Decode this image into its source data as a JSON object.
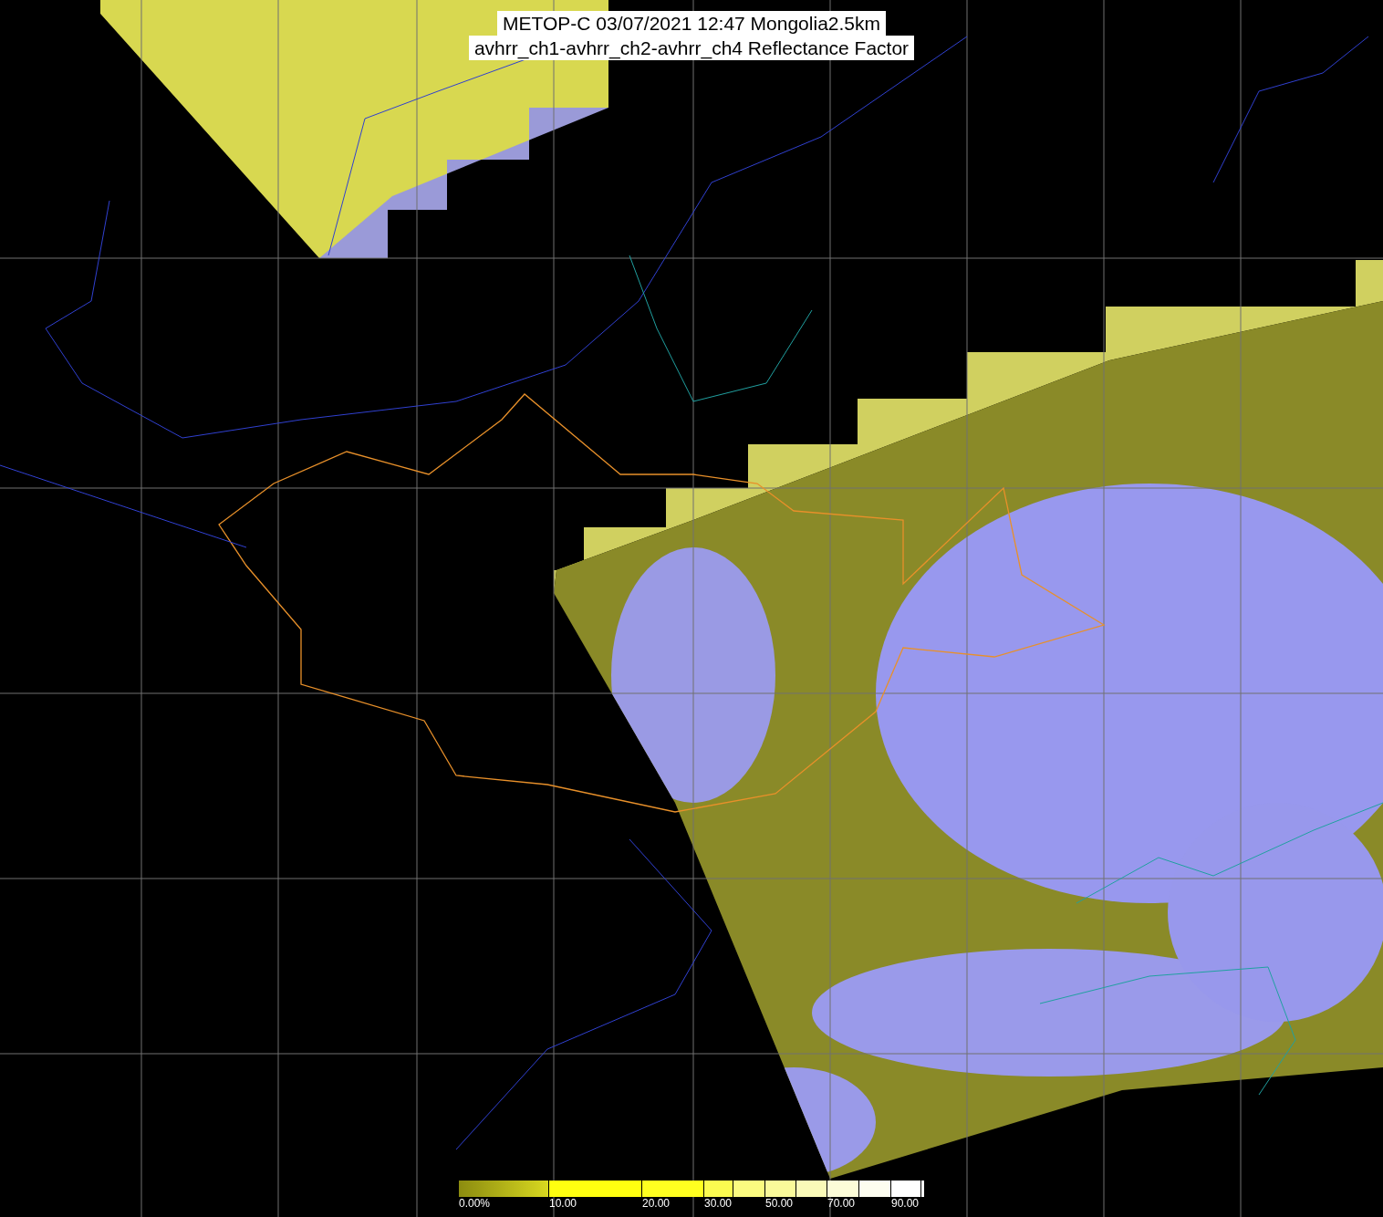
{
  "title": {
    "lines": [
      "METOP-C 03/07/2021 12:47 Mongolia2.5km",
      "avhrr_ch1-avhrr_ch2-avhrr_ch4 Reflectance Factor"
    ]
  },
  "colorbar": {
    "labels": [
      "0.00%",
      "10.00",
      "20.00",
      "30.00",
      "50.00",
      "70.00",
      "90.00"
    ]
  }
}
